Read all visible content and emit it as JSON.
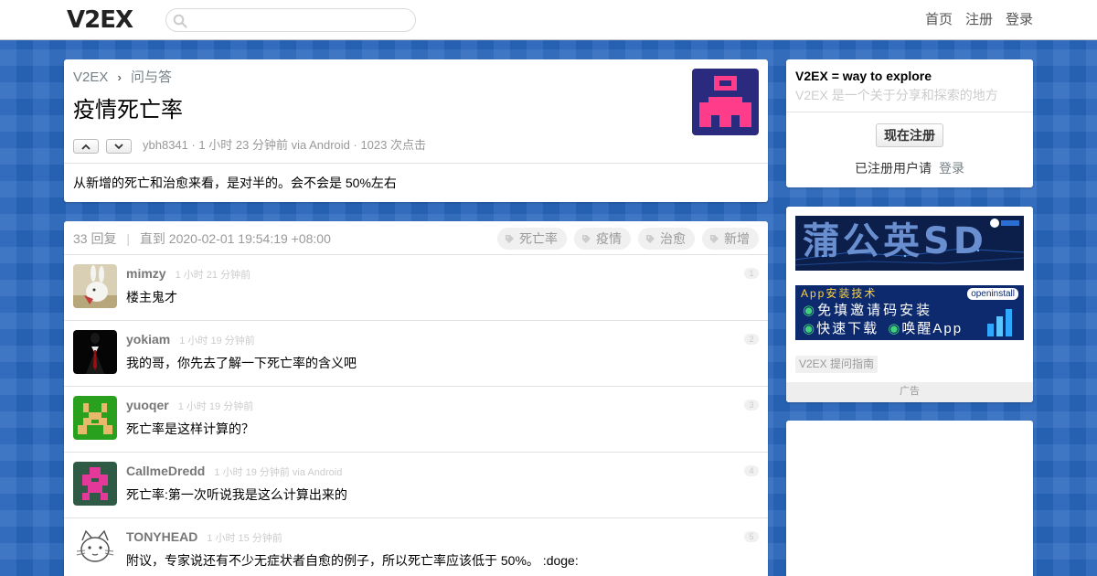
{
  "header": {
    "logo": "V2EX",
    "search": {
      "placeholder": ""
    },
    "nav": [
      "首页",
      "注册",
      "登录"
    ]
  },
  "topic": {
    "breadcrumb": {
      "site": "V2EX",
      "separator": "›",
      "node": "问与答"
    },
    "title": "疫情死亡率",
    "meta": "ybh8341 · 1 小时 23 分钟前 via Android · 1023 次点击",
    "content": "从新增的死亡和治愈来看，是对半的。会不会是 50%左右"
  },
  "replies_header": {
    "count": "33 回复",
    "separator": "|",
    "until": "直到 2020-02-01 19:54:19 +08:00",
    "tags": [
      "死亡率",
      "疫情",
      "治愈",
      "新增"
    ]
  },
  "replies": [
    {
      "user": "mimzy",
      "time": "1 小时 21 分钟前",
      "text": "楼主鬼才",
      "num": "1"
    },
    {
      "user": "yokiam",
      "time": "1 小时 19 分钟前",
      "text": "我的哥，你先去了解一下死亡率的含义吧",
      "num": "2"
    },
    {
      "user": "yuoqer",
      "time": "1 小时 19 分钟前",
      "text": "死亡率是这样计算的？",
      "num": "3"
    },
    {
      "user": "CallmeDredd",
      "time": "1 小时 19 分钟前 via Android",
      "text": "死亡率:第一次听说我是这么计算出来的",
      "num": "4"
    },
    {
      "user": "TONYHEAD",
      "time": "1 小时 15 分钟前",
      "text": "附议，专家说还有不少无症状者自愈的例子，所以死亡率应该低于 50%。 :doge:",
      "num": "5"
    }
  ],
  "sidebar": {
    "intro_title": "V2EX = way to explore",
    "intro_sub": "V2EX 是一个关于分享和探索的地方",
    "signup_button": "现在注册",
    "registered": "已注册用户请",
    "login": "登录",
    "ad1_text": "蒲公英SD",
    "ad2": {
      "line1": "App安装技术",
      "line2": "免填邀请码安装",
      "line3": "快速下载",
      "line4": "唤醒App",
      "brand": "openinstall"
    },
    "guide": "V2EX 提问指南",
    "ad_label": "广告"
  },
  "colors": {
    "background": "#2a68bf",
    "topic_avatar_bg": "#2a2a7e",
    "topic_avatar_fg": "#ff3c8a",
    "ad1_bg": "#0c1e4a",
    "ad2_bg": "#0d2a6e"
  }
}
